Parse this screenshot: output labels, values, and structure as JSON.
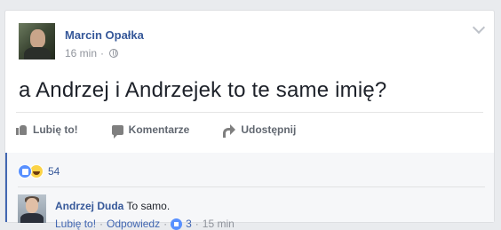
{
  "post": {
    "author": "Marcin Opałka",
    "time": "16 min",
    "separator": "·",
    "text": "a Andrzej i Andrzejek to te same imię?"
  },
  "actions": {
    "like": "Lubię to!",
    "comment": "Komentarze",
    "share": "Udostępnij"
  },
  "reactions": {
    "count": "54"
  },
  "comment": {
    "author": "Andrzej Duda",
    "text": "To samo.",
    "like": "Lubię to!",
    "reply": "Odpowiedz",
    "likes": "3",
    "time": "15 min",
    "dot": "·"
  },
  "icons": {
    "like": "thumbs-up-icon",
    "comment": "comment-icon",
    "share": "share-arrow-icon",
    "privacy": "globe-icon",
    "menu": "chevron-down-icon",
    "reaction_like": "like-reaction-icon",
    "reaction_haha": "haha-reaction-icon"
  },
  "colors": {
    "link": "#365899",
    "accent": "#4267b2",
    "muted": "#90949c"
  }
}
